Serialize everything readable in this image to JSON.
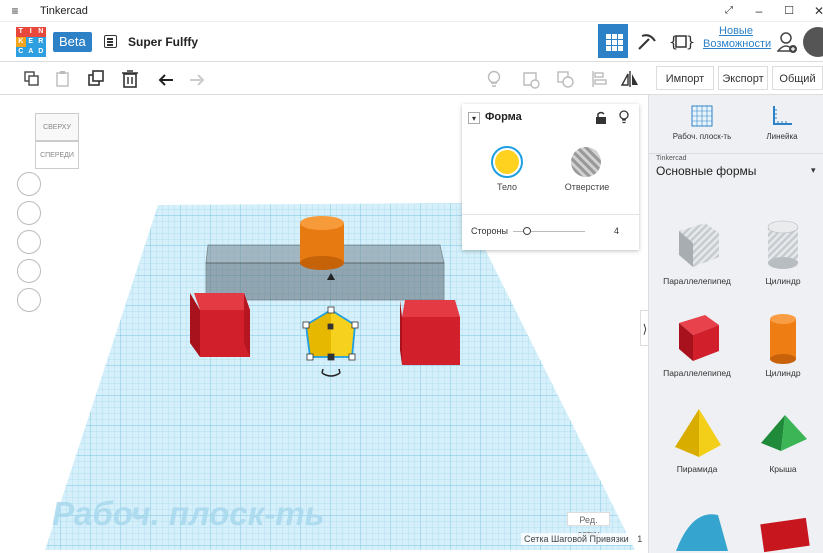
{
  "window": {
    "app_title": "Tinkercad"
  },
  "header": {
    "logo_letters": [
      "T",
      "I",
      "N",
      "K",
      "E",
      "R",
      "C",
      "A",
      "D"
    ],
    "beta_label": "Beta",
    "project_name": "Super Fulffy",
    "news_line1": "Новые",
    "news_line2": "Возможности"
  },
  "toolbar": {
    "import_label": "Импорт",
    "export_label": "Экспорт",
    "share_label": "Общий до"
  },
  "viewcube": {
    "top_label": "СВЕРХУ",
    "front_label": "СПЕРЕДИ"
  },
  "shape_panel": {
    "title": "Форма",
    "solid_label": "Тело",
    "hole_label": "Отверстие",
    "sides_label": "Стороны",
    "sides_value": "4",
    "solid_color": "#ffd21f"
  },
  "workplane": {
    "watermark": "Рабоч. плоск-ть",
    "edit_grid_label": "Ред. сетку",
    "snap_grid_label": "Сетка Шаговой Привязки",
    "snap_grid_value": "1"
  },
  "library": {
    "workplane_btn": "Рабоч. плоск-ть",
    "ruler_btn": "Линейка",
    "source_label": "Tinkercad",
    "category": "Основные формы",
    "shapes": [
      {
        "label": "Параллелепипед",
        "color": "#bfc4c8"
      },
      {
        "label": "Цилиндр",
        "color": "#c8ccd0"
      },
      {
        "label": "Параллелепипед",
        "color": "#d11f2c"
      },
      {
        "label": "Цилиндр",
        "color": "#ee7d14"
      },
      {
        "label": "Пирамида",
        "color": "#f2cc18"
      },
      {
        "label": "Крыша",
        "color": "#2ea84b"
      }
    ]
  }
}
